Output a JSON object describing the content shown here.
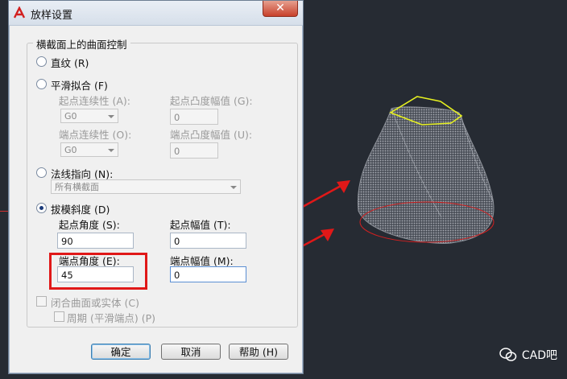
{
  "dialog": {
    "title": "放样设置",
    "close_label": "✕",
    "group_title": "横截面上的曲面控制",
    "ruled": {
      "label": "直纹 (R)",
      "selected": false
    },
    "smooth": {
      "label": "平滑拟合 (F)",
      "selected": false,
      "start_continuity_label": "起点连续性 (A):",
      "start_continuity_value": "G0",
      "start_bulge_label": "起点凸度幅值 (G):",
      "start_bulge_value": "0",
      "end_continuity_label": "端点连续性 (O):",
      "end_continuity_value": "G0",
      "end_bulge_label": "端点凸度幅值 (U):",
      "end_bulge_value": "0"
    },
    "normal": {
      "label": "法线指向 (N):",
      "selected": false,
      "value": "所有横截面"
    },
    "draft": {
      "label": "拔模斜度 (D)",
      "selected": true,
      "start_angle_label": "起点角度 (S):",
      "start_angle_value": "90",
      "start_magnitude_label": "起点幅值 (T):",
      "start_magnitude_value": "0",
      "end_angle_label": "端点角度 (E):",
      "end_angle_value": "45",
      "end_magnitude_label": "端点幅值 (M):",
      "end_magnitude_value": "0"
    },
    "close_surface": {
      "label": "闭合曲面或实体 (C)",
      "checked": false
    },
    "periodic": {
      "label": "周期 (平滑端点) (P)",
      "checked": false
    },
    "ok_label": "确定",
    "cancel_label": "取消",
    "help_label": "帮助 (H)"
  },
  "watermark": {
    "text": "CAD吧"
  },
  "colors": {
    "background": "#262b33",
    "highlight_box": "#e01818",
    "arrow": "#e01818",
    "profile_top": "#e6f020",
    "profile_bottom": "#d42020"
  }
}
